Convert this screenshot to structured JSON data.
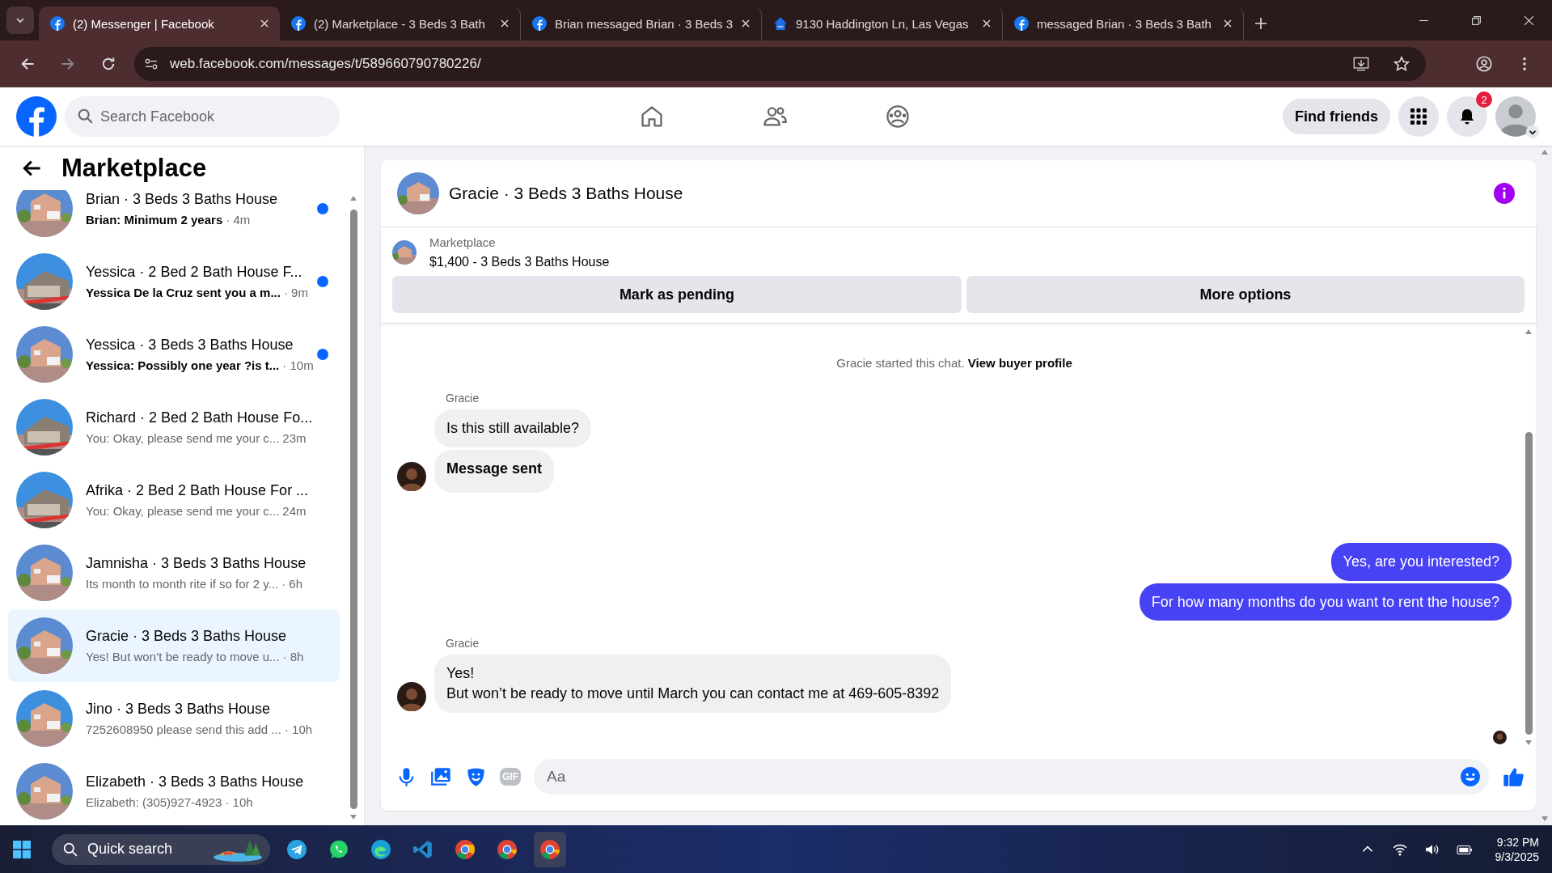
{
  "browser": {
    "tabs": [
      {
        "title": "(2) Messenger | Facebook",
        "selected": true
      },
      {
        "title": "(2) Marketplace - 3 Beds 3 Bath",
        "selected": false
      },
      {
        "title": "Brian messaged Brian · 3 Beds 3",
        "selected": false
      },
      {
        "title": "9130 Haddington Ln, Las Vegas",
        "selected": false
      },
      {
        "title": "messaged Brian · 3 Beds 3 Bath",
        "selected": false
      }
    ],
    "url": "web.facebook.com/messages/t/589660790780226/"
  },
  "header": {
    "search": {
      "placeholder": "Search Facebook"
    },
    "find_friends": "Find friends",
    "notifications": "2"
  },
  "sidebar": {
    "title": "Marketplace",
    "conversations": [
      {
        "name": "Brian · 3 Beds 3 Baths House",
        "preview": "Brian: Minimum 2 years",
        "time": "· 4m",
        "unread": true,
        "selected": false
      },
      {
        "name": "Yessica · 2 Bed 2 Bath House F...",
        "preview": "Yessica De la Cruz sent you a m...",
        "time": "· 9m",
        "unread": true,
        "selected": false
      },
      {
        "name": "Yessica · 3 Beds 3 Baths House",
        "preview": "Yessica: Possibly one year ?is t...",
        "time": "· 10m",
        "unread": true,
        "selected": false
      },
      {
        "name": "Richard · 2 Bed 2 Bath House Fo...",
        "preview": "You: Okay, please send me your c...",
        "time": "23m",
        "unread": false,
        "selected": false
      },
      {
        "name": "Afrika · 2 Bed 2 Bath House For ...",
        "preview": "You: Okay, please send me your c...",
        "time": "24m",
        "unread": false,
        "selected": false
      },
      {
        "name": "Jamnisha · 3 Beds 3 Baths House",
        "preview": "Its month to month rite if so for 2 y...",
        "time": "· 6h",
        "unread": false,
        "selected": false
      },
      {
        "name": "Gracie · 3 Beds 3 Baths House",
        "preview": "Yes! But won’t be ready to move u...",
        "time": "· 8h",
        "unread": false,
        "selected": true
      },
      {
        "name": "Jino · 3 Beds 3 Baths House",
        "preview": "7252608950 please send this add ...",
        "time": "· 10h",
        "unread": false,
        "selected": false
      },
      {
        "name": "Elizabeth · 3 Beds 3 Baths House",
        "preview": "Elizabeth: (305)927-4923",
        "time": "· 10h",
        "unread": false,
        "selected": false
      }
    ]
  },
  "chat": {
    "title": "Gracie · 3 Beds 3 Baths House",
    "listing": {
      "label": "Marketplace",
      "title": "$1,400 - 3 Beds 3 Baths House"
    },
    "actions": [
      "Mark as pending",
      "More options"
    ],
    "messages": [
      {
        "kind": "system",
        "text": "Gracie started this chat.",
        "link": "View buyer profile"
      },
      {
        "kind": "received",
        "sender": "Gracie",
        "bubbles": [
          {
            "text": "Is this still available?",
            "bold": false
          },
          {
            "text": "Message sent",
            "bold": true
          }
        ]
      },
      {
        "kind": "sent",
        "bubbles": [
          {
            "text": "Yes, are you interested?",
            "bold": false
          },
          {
            "text": "For how many months do you want to rent the house?",
            "bold": false
          }
        ]
      },
      {
        "kind": "received",
        "sender": "Gracie",
        "bubbles": [
          {
            "text": "Yes!\nBut won’t be ready to move until March you can contact me at 469-605-8392",
            "bold": false
          }
        ]
      }
    ],
    "composer": {
      "placeholder": "Aa",
      "gif": "GIF"
    }
  },
  "taskbar": {
    "search": "Quick search",
    "time": "9:32 PM",
    "date": "9/3/2025"
  }
}
